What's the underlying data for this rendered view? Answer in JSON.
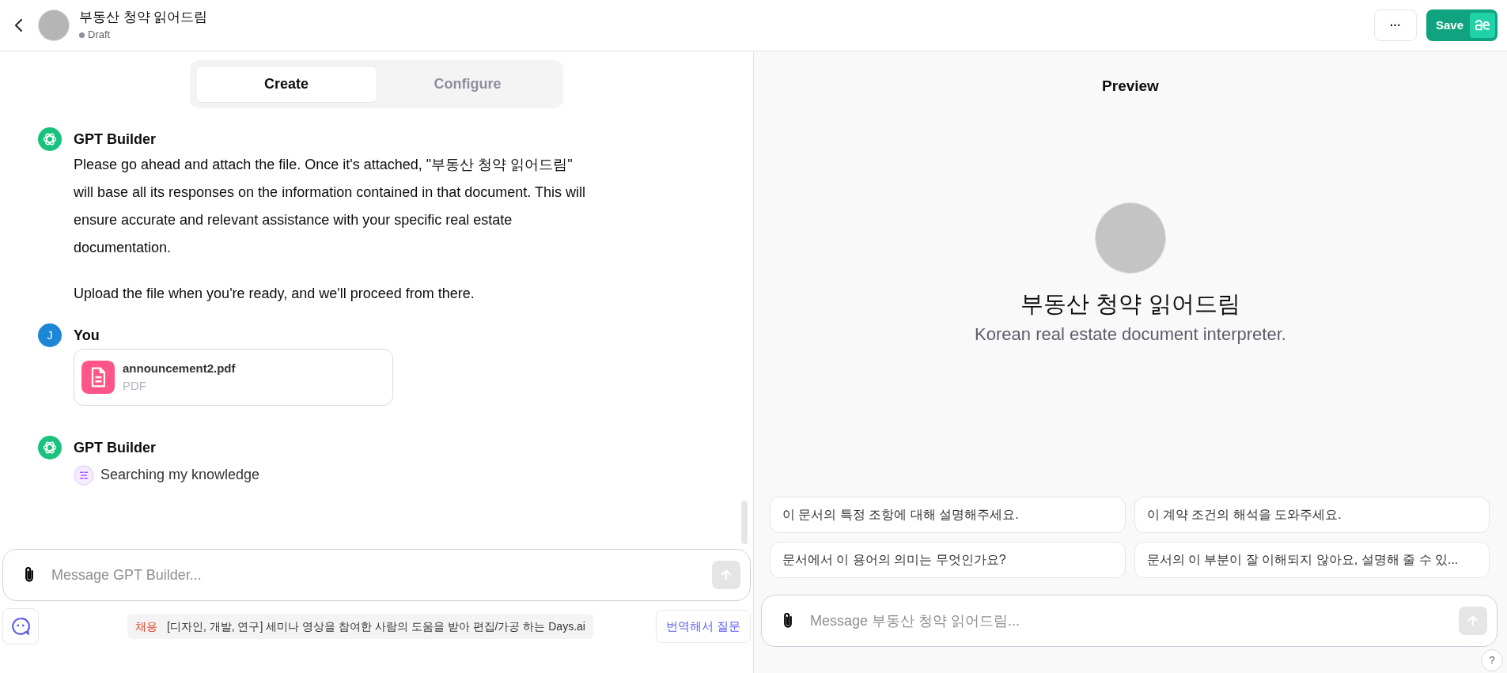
{
  "header": {
    "title": "부동산 청약 읽어드림",
    "status": "Draft",
    "save_label": "Save",
    "more_label": "···"
  },
  "tabs": [
    {
      "label": "Create",
      "selected": true
    },
    {
      "label": "Configure",
      "selected": false
    }
  ],
  "messages": [
    {
      "author": "GPT Builder",
      "avatar": {
        "kind": "bot"
      },
      "kind": "text",
      "paragraphs": [
        "Please go ahead and attach the file. Once it's attached, \"부동산 청약 읽어드림\" will base all its responses on the information contained in that document. This will ensure accurate and relevant assistance with your specific real estate documentation.",
        "Upload the file when you're ready, and we'll proceed from there."
      ]
    },
    {
      "author": "You",
      "avatar": {
        "kind": "user",
        "letter": "J"
      },
      "kind": "file",
      "file": {
        "name": "announcement2.pdf",
        "type": "PDF"
      }
    },
    {
      "author": "GPT Builder",
      "avatar": {
        "kind": "bot"
      },
      "kind": "status",
      "status": "Searching my knowledge"
    }
  ],
  "composer": {
    "placeholder": "Message GPT Builder..."
  },
  "ad": {
    "tag": "채용",
    "text": "[디자인, 개발, 연구] 세미나 영상을 참여한 사람의 도움을 받아 편집/가공 하는 Days.ai"
  },
  "translate_button": "번역해서 질문",
  "preview": {
    "heading": "Preview",
    "name": "부동산 청약 읽어드림",
    "description": "Korean real estate document interpreter.",
    "suggestions": [
      "이 문서의 특정 조항에 대해 설명해주세요.",
      "이 계약 조건의 해석을 도와주세요.",
      "문서에서 이 용어의 의미는 무엇인가요?",
      "문서의 이 부분이 잘 이해되지 않아요, 설명해 줄 수 있..."
    ],
    "placeholder": "Message 부동산 청약 읽어드림...",
    "help": "?"
  }
}
